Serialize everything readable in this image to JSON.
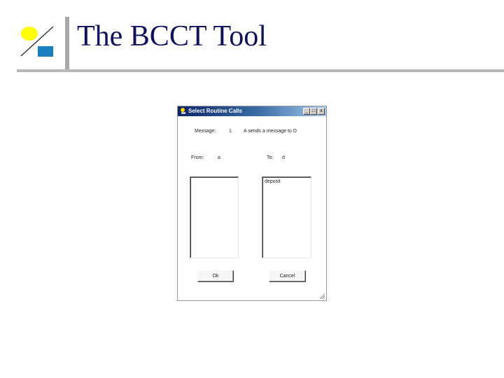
{
  "slide": {
    "title": "The BCCT Tool"
  },
  "dialog": {
    "title": "Select Routine Calls",
    "controls": {
      "minimize": "_",
      "maximize": "□",
      "close": "x"
    },
    "message_label": "Message:",
    "message_number": "1",
    "message_text": "A sends a message to D",
    "from_label": "From:",
    "from_value": "a",
    "to_label": "To:",
    "to_value": "d",
    "from_list": [],
    "to_list": [
      "deposit"
    ],
    "ok_label": "Ok",
    "cancel_label": "Cancel"
  },
  "colors": {
    "title_text": "#101060",
    "logo_yellow": "#ffff00",
    "logo_blue": "#1a7fc0",
    "titlebar_dark": "#0a246a"
  }
}
